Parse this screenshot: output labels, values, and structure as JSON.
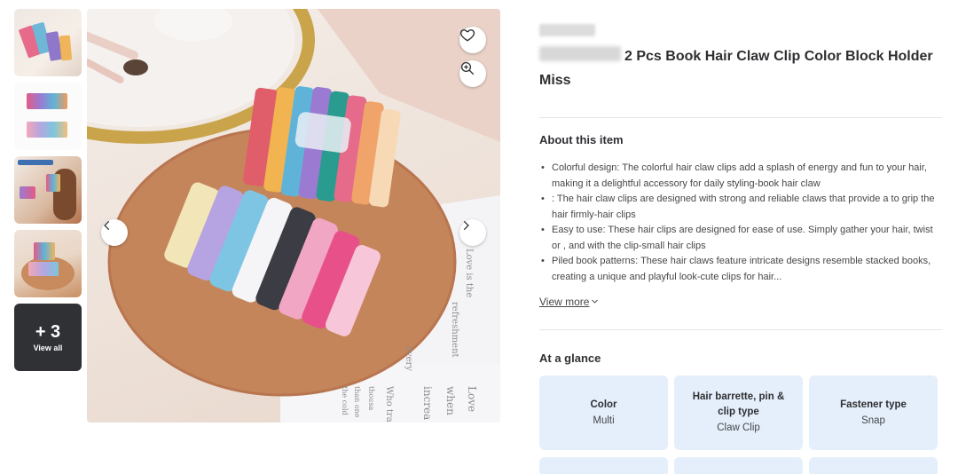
{
  "gallery": {
    "more": {
      "count": "+ 3",
      "label": "View all"
    }
  },
  "hero": {
    "packaging_text": [
      "Love is the",
      "refreshment",
      "every",
      "Love",
      "when",
      "increa",
      "Who tra",
      "thousa",
      "than one",
      "the cold"
    ]
  },
  "product": {
    "title": "2 Pcs Book Hair Claw Clip Color Block Holder Miss"
  },
  "about": {
    "heading": "About this item",
    "bullets": [
      "Colorful design: The colorful hair claw clips add a splash of energy and fun to your hair, making it a delightful accessory for daily styling-book hair claw",
      ": The hair claw clips are designed with strong and reliable claws that provide a to grip the hair firmly-hair clips",
      "Easy to use: These hair clips are designed for ease of use. Simply gather your hair, twist or , and with the clip-small hair clips",
      "Piled book patterns: These hair claws feature intricate designs resemble stacked books, creating a unique and playful look-cute clips for hair..."
    ],
    "view_more": "View more"
  },
  "glance": {
    "heading": "At a glance",
    "cards": [
      {
        "key": "Color",
        "value": "Multi"
      },
      {
        "key": "Hair barrette, pin & clip type",
        "value": "Claw Clip"
      },
      {
        "key": "Fastener type",
        "value": "Snap"
      }
    ]
  },
  "colors": {
    "card_bg": "#e5effb",
    "text_primary": "#2e2f32",
    "divider": "#e6e7e8"
  },
  "icons": [
    "heart-icon",
    "zoom-in-icon",
    "chevron-left-icon",
    "chevron-right-icon",
    "chevron-down-icon"
  ]
}
